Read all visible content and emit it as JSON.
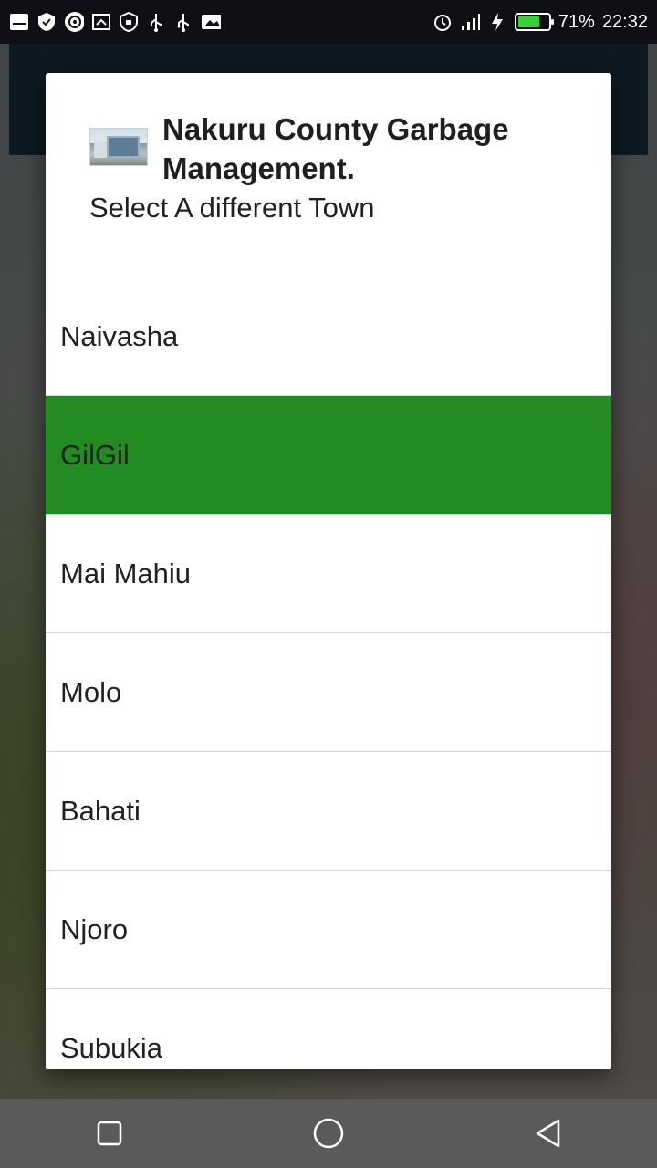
{
  "status_bar": {
    "left_icons": [
      "notification-icon",
      "shield-icon",
      "app-icon",
      "screenshot-icon",
      "security-icon",
      "usb-icon",
      "usb-debug-icon",
      "image-icon"
    ],
    "right_icons": [
      "alarm-icon",
      "signal-icon",
      "charging-icon",
      "battery-icon"
    ],
    "battery_percent_text": "71%",
    "battery_level": 0.71,
    "time": "22:32"
  },
  "dialog": {
    "title": "Nakuru County Garbage Management.",
    "subtitle": "Select A different Town",
    "towns": [
      {
        "label": "Naivasha",
        "selected": false
      },
      {
        "label": "GilGil",
        "selected": true
      },
      {
        "label": "Mai Mahiu",
        "selected": false
      },
      {
        "label": "Molo",
        "selected": false
      },
      {
        "label": "Bahati",
        "selected": false
      },
      {
        "label": "Njoro",
        "selected": false
      },
      {
        "label": "Subukia",
        "selected": false
      }
    ]
  },
  "nav_bar": {
    "buttons": [
      "recents-button",
      "home-button",
      "back-button"
    ]
  },
  "colors": {
    "selected": "#228b22",
    "status_bar": "#0e1015",
    "nav_bar": "#5a5a5a"
  }
}
